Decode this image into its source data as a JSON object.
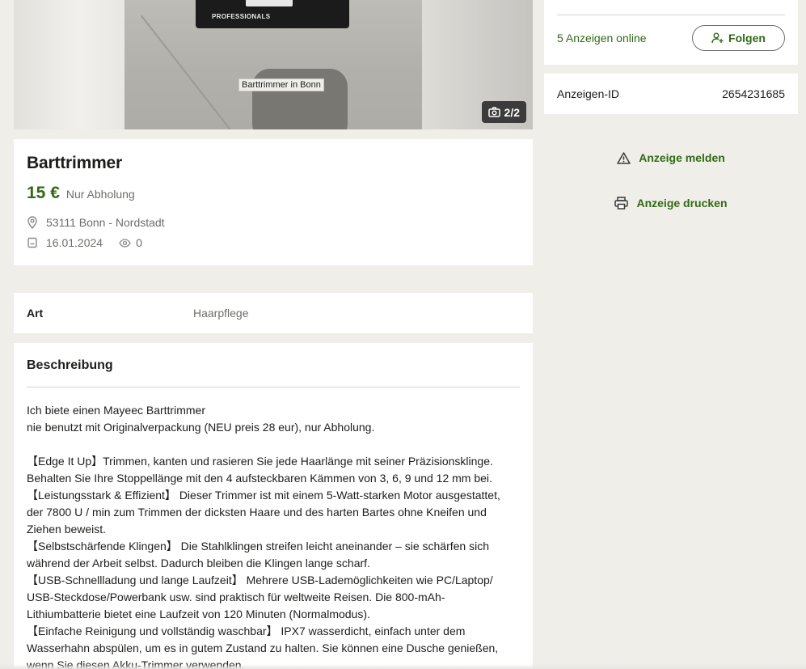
{
  "gallery": {
    "box_text": "PROFESSIONALS",
    "caption": "Barttrimmer in Bonn",
    "counter": "2/2"
  },
  "listing": {
    "title": "Barttrimmer",
    "price": "15 €",
    "shipping": "Nur Abholung",
    "location": "53111 Bonn - Nordstadt",
    "date": "16.01.2024",
    "views": "0"
  },
  "attributes": [
    {
      "key": "Art",
      "value": "Haarpflege"
    }
  ],
  "description": {
    "heading": "Beschreibung",
    "lines": [
      "Ich biete einen Mayeec Barttrimmer",
      "nie benutzt mit Originalverpackung (NEU preis 28 eur), nur Abholung.",
      "",
      "【Edge It Up】Trimmen, kanten und rasieren Sie jede Haarlänge mit seiner Präzisionsklinge.",
      "Behalten Sie Ihre Stoppellänge mit den 4 aufsteckbaren Kämmen von 3, 6, 9 und 12 mm bei.",
      "【Leistungsstark & Effizient】 Dieser Trimmer ist mit einem 5-Watt-starken Motor ausgestattet,",
      "der 7800 U / min zum Trimmen der dicksten Haare und des harten Bartes ohne Kneifen und",
      "Ziehen beweist.",
      "【Selbstschärfende Klingen】 Die Stahlklingen streifen leicht aneinander – sie schärfen sich",
      "während der Arbeit selbst. Dadurch bleiben die Klingen lange scharf.",
      "【USB-Schnellladung und lange Laufzeit】 Mehrere USB-Lademöglichkeiten wie PC/Laptop/",
      "USB-Steckdose/Powerbank usw. sind praktisch für weltweite Reisen. Die 800-mAh-",
      "Lithiumbatterie bietet eine Laufzeit von 120 Minuten (Normalmodus).",
      "【Einfache Reinigung und vollständig waschbar】 IPX7 wasserdicht, einfach unter dem",
      "Wasserhahn abspülen, um es in gutem Zustand zu halten. Sie können eine Dusche genießen,",
      "wenn Sie diesen Akku-Trimmer verwenden."
    ]
  },
  "seller": {
    "online_text": "5 Anzeigen online",
    "follow_label": "Folgen"
  },
  "ad_id": {
    "label": "Anzeigen-ID",
    "value": "2654231685"
  },
  "actions": {
    "report_label": "Anzeige melden",
    "print_label": "Anzeige drucken"
  },
  "colors": {
    "accent": "#326916",
    "background": "#efeee9",
    "muted_text": "#6d6d69"
  }
}
